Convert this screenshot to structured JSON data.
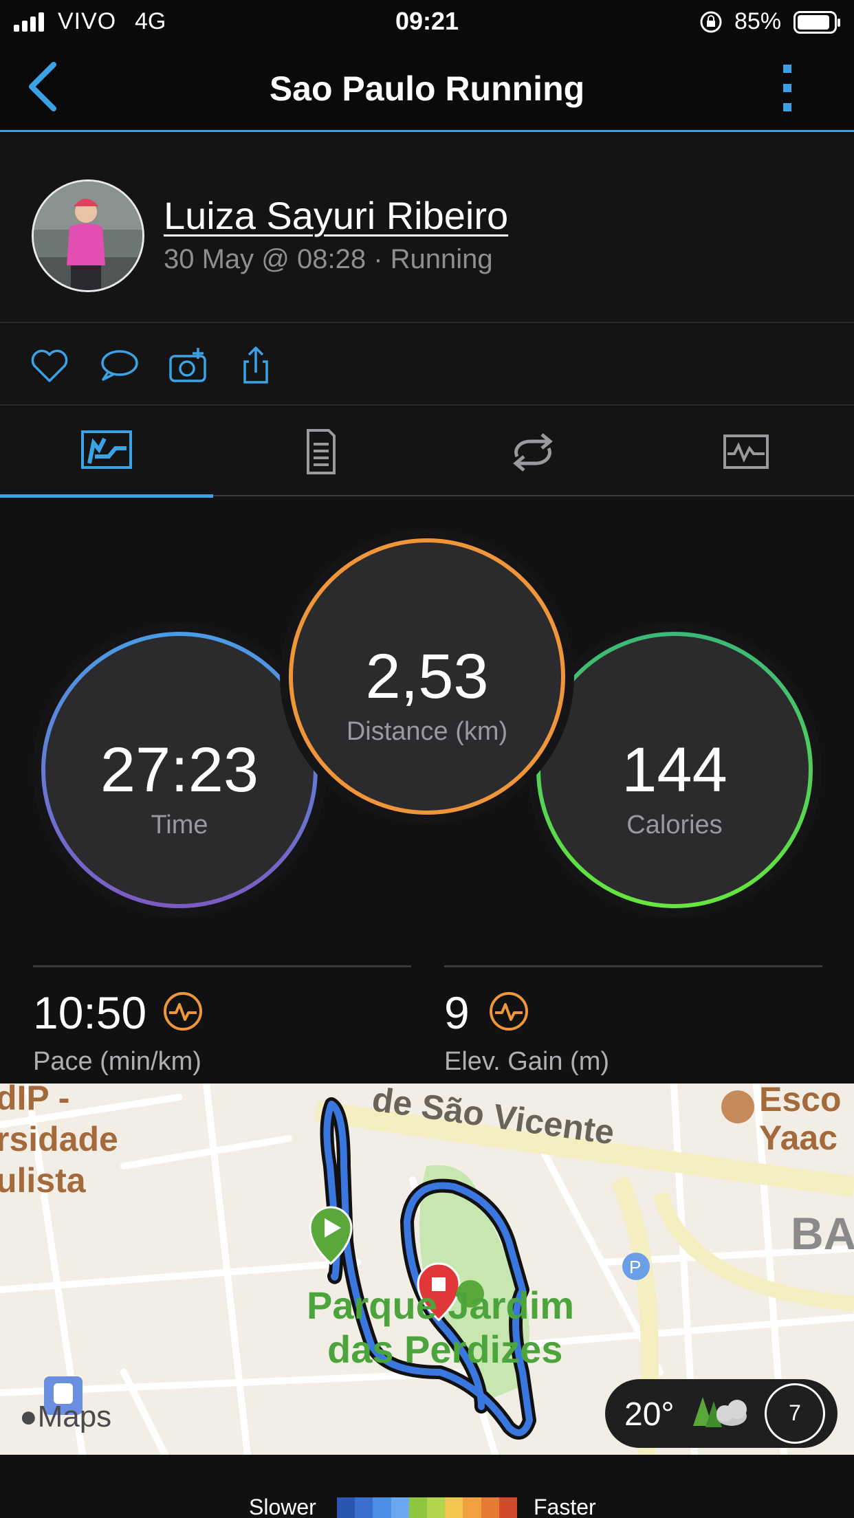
{
  "status_bar": {
    "carrier": "VIVO",
    "network": "4G",
    "time": "09:21",
    "battery": "85%"
  },
  "header": {
    "title": "Sao Paulo Running",
    "back_icon": "chevron-left-icon",
    "menu_icon": "more-vertical-icon"
  },
  "profile": {
    "name": "Luiza Sayuri Ribeiro",
    "meta": "30 May @ 08:28 · Running"
  },
  "actions": [
    "heart-icon",
    "comment-icon",
    "add-photo-icon",
    "share-icon"
  ],
  "tabs": [
    {
      "icon": "map-stats-icon",
      "active": true
    },
    {
      "icon": "details-icon",
      "active": false
    },
    {
      "icon": "laps-icon",
      "active": false
    },
    {
      "icon": "charts-icon",
      "active": false
    }
  ],
  "stats": {
    "time": {
      "value": "27:23",
      "label": "Time"
    },
    "distance": {
      "value": "2,53",
      "label": "Distance (km)"
    },
    "calories": {
      "value": "144",
      "label": "Calories"
    },
    "pace": {
      "value": "10:50",
      "label": "Pace (min/km)"
    },
    "elevation": {
      "value": "9",
      "label": "Elev. Gain (m)"
    }
  },
  "map": {
    "labels": {
      "street": "de São Vicente",
      "left_top": "dIP -",
      "left_mid": "rsidade",
      "left_bot": "ulista",
      "right_top": "Esco",
      "right_mid": "Yaac",
      "right_ba": "BA",
      "park_line1": "Parque Jardim",
      "park_line2": "das Perdizes",
      "provider": "Maps"
    },
    "weather": {
      "temp": "20°",
      "index": "7"
    }
  },
  "legend": {
    "slower": "Slower",
    "faster": "Faster",
    "colors": [
      "#2a55b0",
      "#3a6fd0",
      "#4a8ee6",
      "#6aa8f0",
      "#8ec640",
      "#b2d44c",
      "#f2c64c",
      "#f0a040",
      "#e47a34",
      "#d24a2c"
    ]
  },
  "colors": {
    "accent": "#3aa3e6",
    "time_ring": "#4a8fe0",
    "distance_ring": "#f0963a",
    "calories_ring": "#56d456"
  }
}
